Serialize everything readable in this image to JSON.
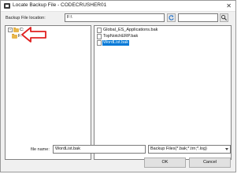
{
  "window": {
    "title": "Locate Backup File - CODECRUSHER01",
    "close_glyph": "✕"
  },
  "location": {
    "label": "Backup File location:",
    "value": "F:\\",
    "search_value": ""
  },
  "tree": {
    "nodes": [
      {
        "label": "C:",
        "expander": "+"
      },
      {
        "label": "F:",
        "expander": ""
      }
    ]
  },
  "files": [
    {
      "name": "Global_ES_Applications.bak",
      "selected": false
    },
    {
      "name": "TopNotchERP.bak",
      "selected": false
    },
    {
      "name": "WordList.bak",
      "selected": true
    }
  ],
  "footer": {
    "filename_label": "file name:",
    "filename_value": "WordList.bak",
    "filter_value": "Backup Files(*.bak;*.trn;*.log)",
    "ok_label": "OK",
    "cancel_label": "Cancel"
  },
  "annotation": {
    "color": "#e02020"
  }
}
